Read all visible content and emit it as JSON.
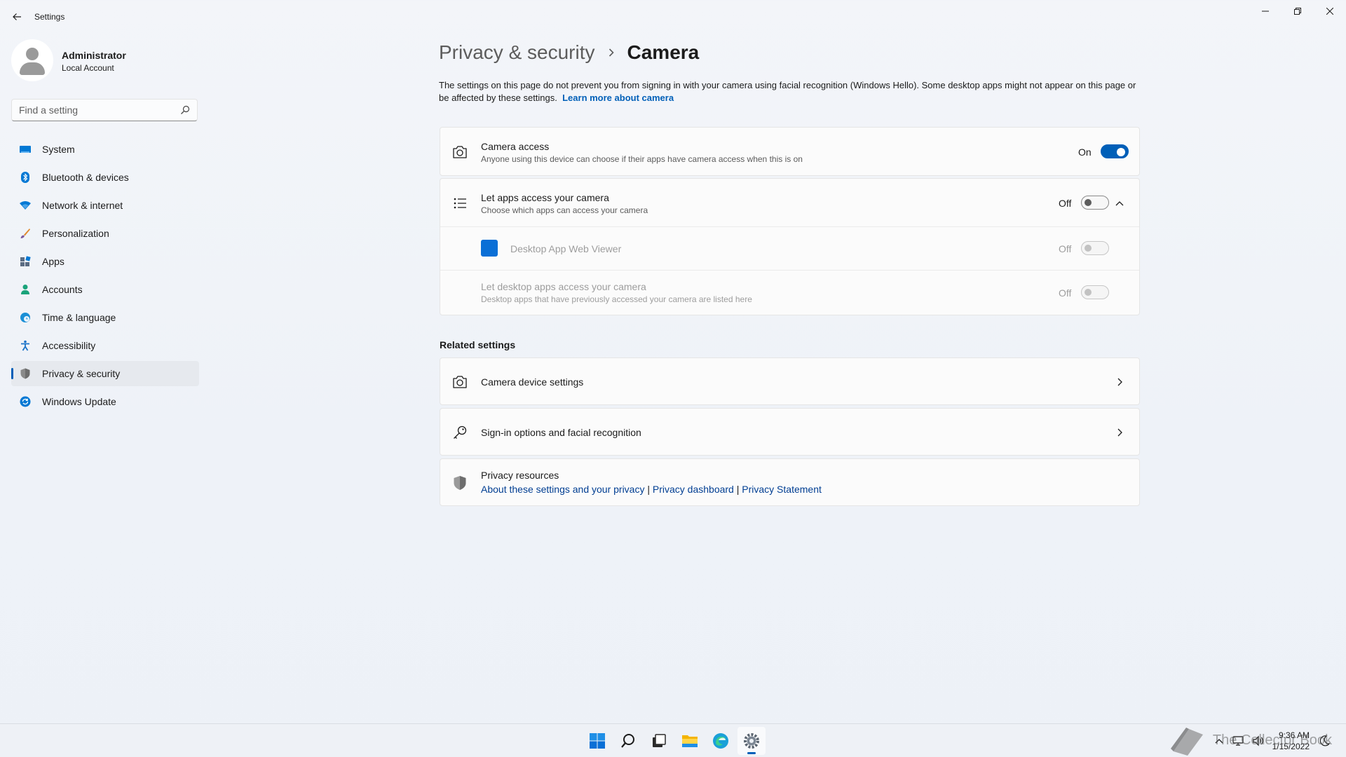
{
  "window": {
    "app_title": "Settings",
    "back_icon": "back-arrow-icon",
    "controls": [
      "minimize-icon",
      "restore-icon",
      "close-icon"
    ]
  },
  "profile": {
    "name": "Administrator",
    "account_type": "Local Account"
  },
  "search": {
    "placeholder": "Find a setting",
    "value": ""
  },
  "sidebar": {
    "items": [
      {
        "label": "System",
        "icon": "monitor-icon",
        "color": "#0078d4"
      },
      {
        "label": "Bluetooth & devices",
        "icon": "bluetooth-icon",
        "color": "#0078d4"
      },
      {
        "label": "Network & internet",
        "icon": "wifi-icon",
        "color": "#0078d4"
      },
      {
        "label": "Personalization",
        "icon": "brush-icon",
        "color": "#d46b08"
      },
      {
        "label": "Apps",
        "icon": "apps-icon",
        "color": "#5a6b82"
      },
      {
        "label": "Accounts",
        "icon": "person-icon",
        "color": "#16a085"
      },
      {
        "label": "Time & language",
        "icon": "globe-clock-icon",
        "color": "#1a8fd6"
      },
      {
        "label": "Accessibility",
        "icon": "accessibility-icon",
        "color": "#1a73c8"
      },
      {
        "label": "Privacy & security",
        "icon": "shield-icon",
        "color": "#7a7a7a"
      },
      {
        "label": "Windows Update",
        "icon": "update-icon",
        "color": "#0078d4"
      }
    ],
    "selected": "Privacy & security"
  },
  "breadcrumb": {
    "parent": "Privacy & security",
    "current": "Camera"
  },
  "description": {
    "text": "The settings on this page do not prevent you from signing in with your camera using facial recognition (Windows Hello). Some desktop apps might not appear on this page or be affected by these settings.",
    "link": "Learn more about camera"
  },
  "camera_access": {
    "title": "Camera access",
    "subtitle": "Anyone using this device can choose if their apps have camera access when this is on",
    "state": "On"
  },
  "apps_access": {
    "title": "Let apps access your camera",
    "subtitle": "Choose which apps can access your camera",
    "state": "Off",
    "expanded": true,
    "apps": [
      {
        "name": "Desktop App Web Viewer",
        "state": "Off",
        "color": "#0a6fd6"
      }
    ],
    "desktop_apps": {
      "title": "Let desktop apps access your camera",
      "subtitle": "Desktop apps that have previously accessed your camera are listed here",
      "state": "Off"
    }
  },
  "related": {
    "heading": "Related settings",
    "items": [
      {
        "label": "Camera device settings",
        "icon": "camera-icon"
      },
      {
        "label": "Sign-in options and facial recognition",
        "icon": "key-icon"
      }
    ]
  },
  "privacy_resources": {
    "title": "Privacy resources",
    "links": [
      "About these settings and your privacy",
      "Privacy dashboard",
      "Privacy Statement"
    ],
    "separator": "|"
  },
  "taskbar": {
    "apps": [
      "windows-start-icon",
      "search-icon",
      "task-view-icon",
      "file-explorer-icon",
      "edge-icon",
      "settings-gear-icon"
    ],
    "active": "settings-gear-icon",
    "time": "9:36 AM",
    "date": "1/15/2022"
  },
  "watermark": "The Collector Book",
  "accent": "#005fb8"
}
